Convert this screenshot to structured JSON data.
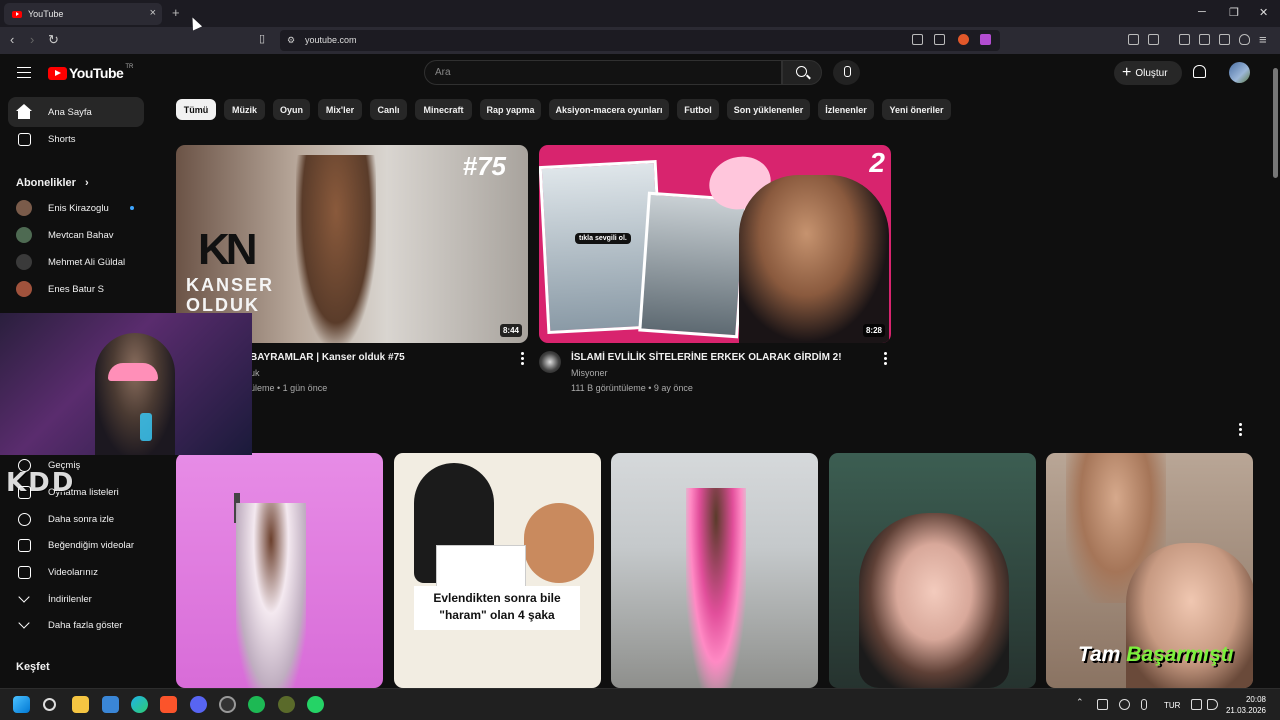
{
  "browser": {
    "tab_title": "YouTube",
    "tab_close": "×",
    "new_tab": "+",
    "url": "youtube.com",
    "window_controls": [
      "─",
      "❐",
      "✕"
    ]
  },
  "header": {
    "logo_word": "YouTube",
    "country_code": "TR",
    "search_placeholder": "Ara",
    "create_label": "Oluştur",
    "create_plus": "+"
  },
  "sidebar": {
    "main": [
      {
        "label": "Ana Sayfa",
        "icon": "home-icon"
      },
      {
        "label": "Shorts",
        "icon": "shorts-icon"
      }
    ],
    "subscriptions_heading": "Abonelikler",
    "subscriptions_chevron": "›",
    "subscriptions": [
      {
        "label": "Enis Kirazoglu",
        "live": true
      },
      {
        "label": "Mevtcan Bahav",
        "live": false
      },
      {
        "label": "Mehmet Ali Güldal",
        "live": false
      },
      {
        "label": "Enes Batur S",
        "live": false
      }
    ],
    "you": [
      {
        "label": "Geçmiş",
        "icon": "history-icon"
      },
      {
        "label": "Oynatma listeleri",
        "icon": "playlist-icon"
      },
      {
        "label": "Daha sonra izle",
        "icon": "clock-icon"
      },
      {
        "label": "Beğendiğim videolar",
        "icon": "like-icon"
      },
      {
        "label": "Videolarınız",
        "icon": "video-icon"
      },
      {
        "label": "İndirilenler",
        "icon": "download-icon"
      },
      {
        "label": "Daha fazla göster",
        "icon": "chevron-down-icon"
      }
    ],
    "explore_heading": "Keşfet"
  },
  "chips": [
    "Tümü",
    "Müzik",
    "Oyun",
    "Mix'ler",
    "Canlı",
    "Minecraft",
    "Rap yapma",
    "Aksiyon-macera oyunları",
    "Futbol",
    "Son yüklenenler",
    "İzlenenler",
    "Yeni öneriler"
  ],
  "videos": [
    {
      "title": "BAYRAMLAR | Kanser olduk #75",
      "channel": "uk",
      "meta": "üleme • 1 gün önce",
      "duration": "8:44",
      "thumb_text_episode": "#75",
      "thumb_logo": "KN",
      "thumb_text_brand": "KANSER OLDUK"
    },
    {
      "title": "İSLAMİ EVLİLİK SİTELERİNE ERKEK OLARAK GİRDİM 2!",
      "channel": "Misyoner",
      "meta": "111 B görüntüleme • 9 ay önce",
      "duration": "8:28",
      "thumb_number": "2",
      "thumb_sticker": "tıkla sevgili ol."
    }
  ],
  "shorts_thumbs": [
    {
      "overlay": ""
    },
    {
      "overlay": "Evlendikten sonra bile \"haram\" olan 4 şaka"
    },
    {
      "overlay": ""
    },
    {
      "overlay": ""
    },
    {
      "overlay": "Tam Başarmıştı",
      "overlay_highlight": "Başarmıştı"
    }
  ],
  "watermark": "KDD",
  "taskbar": {
    "lang": "TUR",
    "time": "20:08",
    "date": "21.03.2026"
  },
  "colors": {
    "background": "#0f0f0f",
    "chip": "#272727",
    "chip_active": "#f1f1f1",
    "brand_red": "#ff0000",
    "meta_text": "#aaaaaa"
  }
}
